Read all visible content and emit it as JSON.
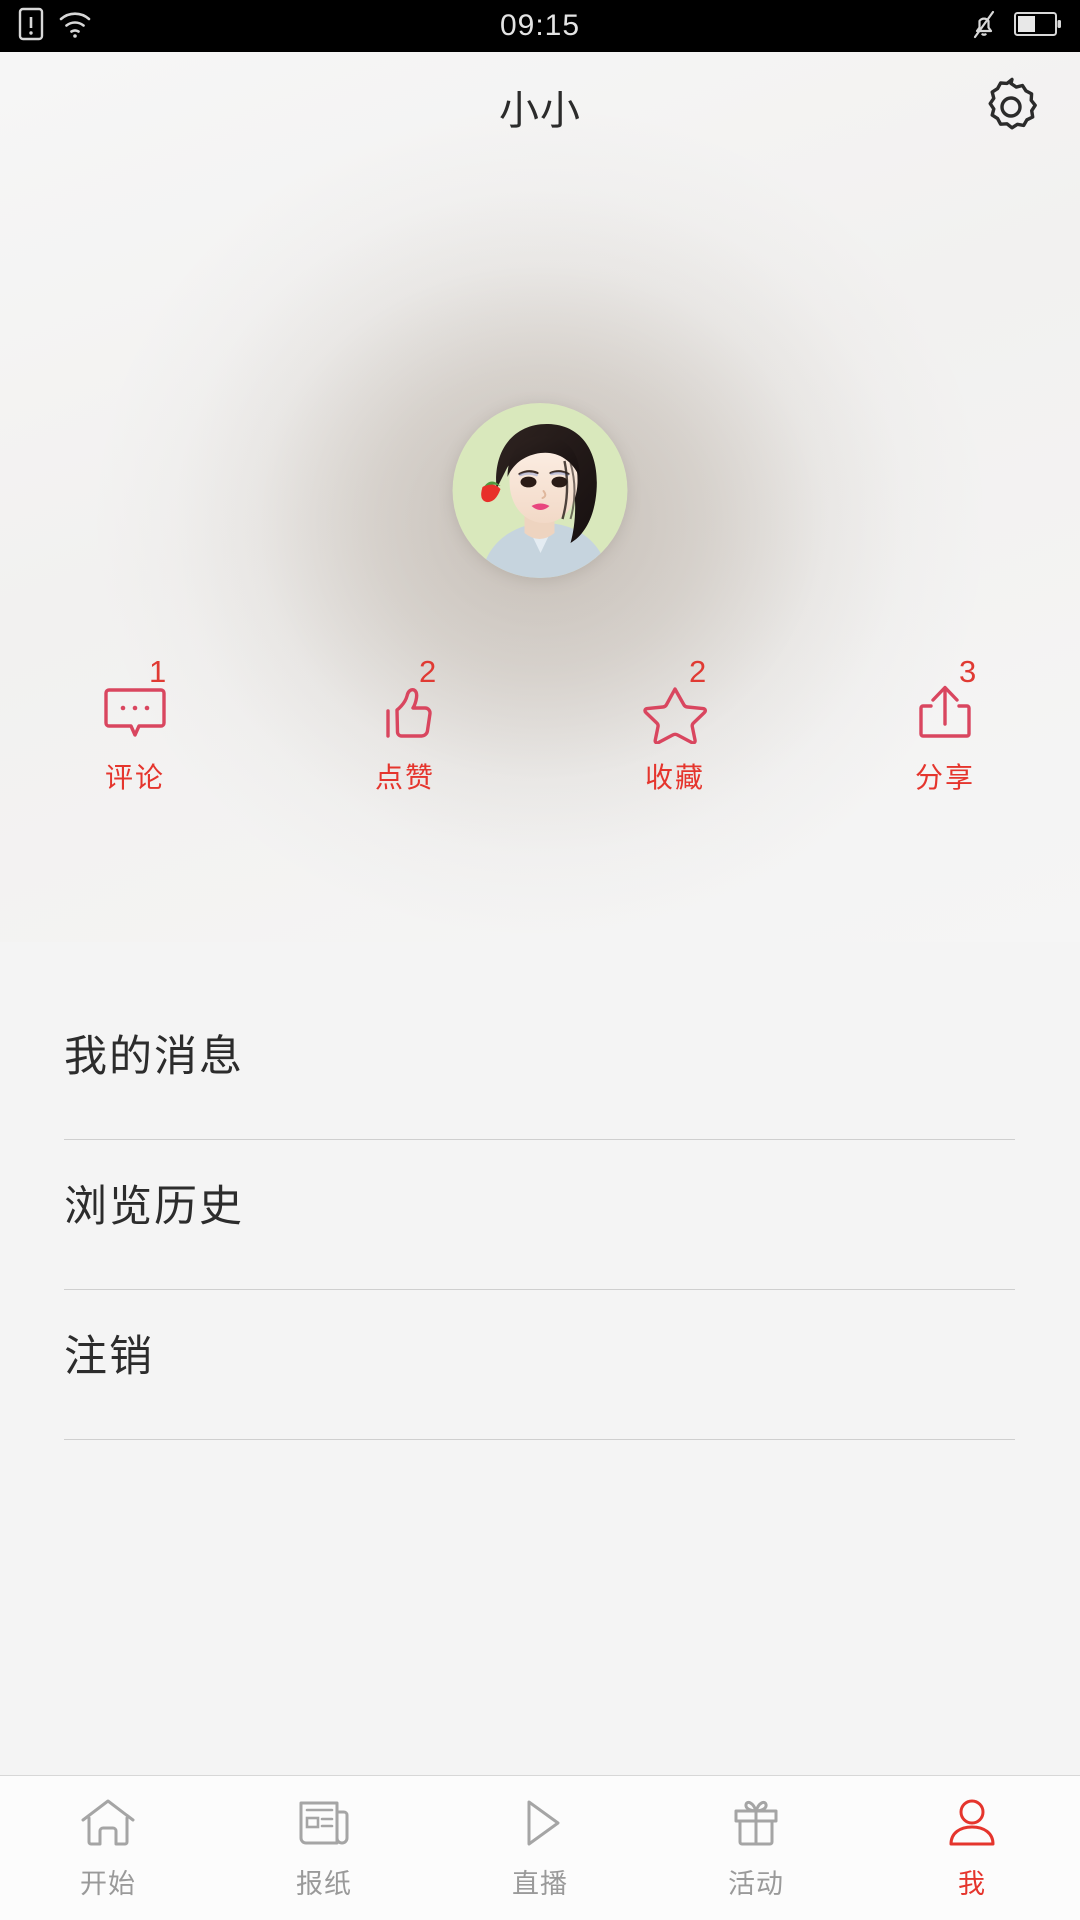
{
  "status_bar": {
    "time": "09:15",
    "left_icons": [
      "sim-alert-icon",
      "wifi-icon"
    ],
    "right_icons": [
      "bell-muted-icon",
      "battery-icon"
    ],
    "background": "#000000"
  },
  "navbar": {
    "title": "小小",
    "settings_icon": "gear-icon"
  },
  "profile": {
    "avatar_icon": "user-avatar-photo",
    "avatar_bg": "#d9e8bc"
  },
  "theme": {
    "accent_red": "#e5352d",
    "count_red": "#e03a33",
    "icon_red": "#d9465f",
    "page_bg": "#f4f4f4",
    "text_dark": "#2c2c2c",
    "tab_gray": "#9a9a9a"
  },
  "actions": [
    {
      "icon": "comment-icon",
      "count": "1",
      "label": "评论"
    },
    {
      "icon": "thumbs-up-icon",
      "count": "2",
      "label": "点赞"
    },
    {
      "icon": "star-icon",
      "count": "2",
      "label": "收藏"
    },
    {
      "icon": "share-icon",
      "count": "3",
      "label": "分享"
    }
  ],
  "menu": [
    {
      "label": "我的消息"
    },
    {
      "label": "浏览历史"
    },
    {
      "label": "注销"
    }
  ],
  "tabbar": [
    {
      "icon": "home-icon",
      "label": "开始",
      "active": false
    },
    {
      "icon": "newspaper-icon",
      "label": "报纸",
      "active": false
    },
    {
      "icon": "play-icon",
      "label": "直播",
      "active": false
    },
    {
      "icon": "gift-icon",
      "label": "活动",
      "active": false
    },
    {
      "icon": "person-icon",
      "label": "我",
      "active": true
    }
  ]
}
